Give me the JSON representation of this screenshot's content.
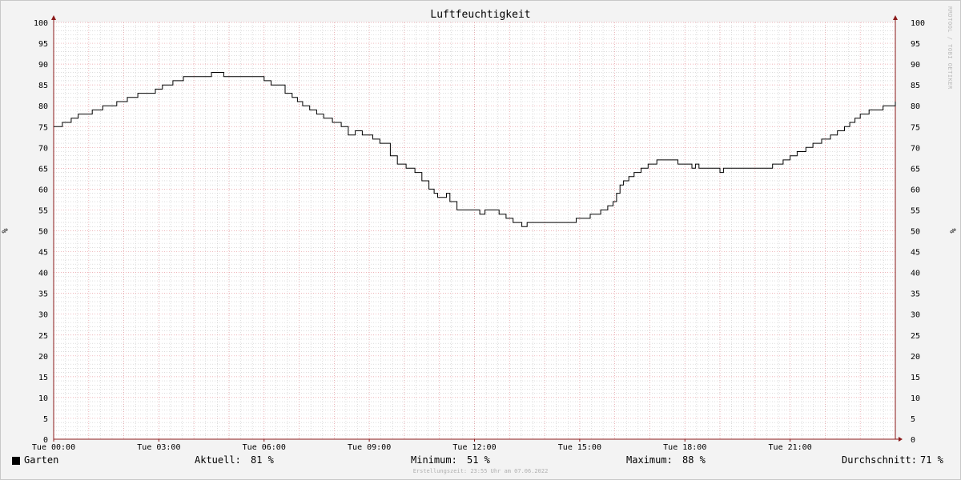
{
  "chart_data": {
    "type": "line",
    "title": "Luftfeuchtigkeit",
    "ylabel": "%",
    "ylim": [
      0,
      100
    ],
    "yticks": [
      0,
      5,
      10,
      15,
      20,
      25,
      30,
      35,
      40,
      45,
      50,
      55,
      60,
      65,
      70,
      75,
      80,
      85,
      90,
      95,
      100
    ],
    "xlim": [
      0,
      24
    ],
    "xticks": [
      {
        "x": 0,
        "label": "Tue 00:00"
      },
      {
        "x": 3,
        "label": "Tue 03:00"
      },
      {
        "x": 6,
        "label": "Tue 06:00"
      },
      {
        "x": 9,
        "label": "Tue 09:00"
      },
      {
        "x": 12,
        "label": "Tue 12:00"
      },
      {
        "x": 15,
        "label": "Tue 15:00"
      },
      {
        "x": 18,
        "label": "Tue 18:00"
      },
      {
        "x": 21,
        "label": "Tue 21:00"
      }
    ],
    "grid": true,
    "legend_position": "bottom-left",
    "series": [
      {
        "name": "Garten",
        "color": "#000000",
        "x": [
          0,
          0.25,
          0.5,
          0.7,
          0.9,
          1.1,
          1.4,
          1.8,
          2.1,
          2.4,
          2.9,
          3.1,
          3.4,
          3.7,
          4.0,
          4.5,
          4.85,
          5.15,
          6.0,
          6.2,
          6.6,
          6.8,
          6.95,
          7.1,
          7.3,
          7.5,
          7.7,
          7.95,
          8.2,
          8.4,
          8.6,
          8.8,
          8.9,
          9.1,
          9.3,
          9.6,
          9.8,
          10.05,
          10.3,
          10.5,
          10.7,
          10.85,
          10.95,
          11.05,
          11.2,
          11.3,
          11.5,
          11.95,
          12.15,
          12.3,
          12.7,
          12.9,
          13.1,
          13.35,
          13.5,
          13.6,
          14.5,
          14.9,
          15.3,
          15.6,
          15.8,
          15.95,
          16.05,
          16.15,
          16.25,
          16.4,
          16.55,
          16.75,
          16.95,
          17.2,
          17.8,
          18.2,
          18.3,
          18.4,
          19.0,
          19.1,
          19.2,
          19.6,
          20.5,
          20.8,
          21.0,
          21.2,
          21.45,
          21.65,
          21.9,
          22.15,
          22.35,
          22.55,
          22.7,
          22.85,
          23.0,
          23.25,
          23.65,
          24.0
        ],
        "values": [
          75,
          76,
          77,
          78,
          78,
          79,
          80,
          81,
          82,
          83,
          84,
          85,
          86,
          87,
          87,
          88,
          87,
          87,
          86,
          85,
          83,
          82,
          81,
          80,
          79,
          78,
          77,
          76,
          75,
          73,
          74,
          73,
          73,
          72,
          71,
          68,
          66,
          65,
          64,
          62,
          60,
          59,
          58,
          58,
          59,
          57,
          55,
          55,
          54,
          55,
          54,
          53,
          52,
          51,
          52,
          52,
          52,
          53,
          54,
          55,
          56,
          57,
          59,
          61,
          62,
          63,
          64,
          65,
          66,
          67,
          66,
          65,
          66,
          65,
          64,
          65,
          65,
          65,
          66,
          67,
          68,
          69,
          70,
          71,
          72,
          73,
          74,
          75,
          76,
          77,
          78,
          79,
          80,
          81
        ]
      }
    ]
  },
  "stats": {
    "current_label": "Aktuell:",
    "current_value": "81 %",
    "min_label": "Minimum:",
    "min_value": "51 %",
    "max_label": "Maximum:",
    "max_value": "88 %",
    "avg_label": "Durchschnitt:",
    "avg_value": "71 %"
  },
  "watermark": "RRDTOOL / TOBI OETIKER",
  "created": "Erstellungszeit: 23:55 Uhr am 07.06.2022",
  "colors": {
    "background": "#f3f3f3",
    "plot": "#ffffff",
    "major_grid": "#e89aa0",
    "minor_grid": "#c8c8c8",
    "axis": "#8b1a1a",
    "line": "#000000"
  }
}
